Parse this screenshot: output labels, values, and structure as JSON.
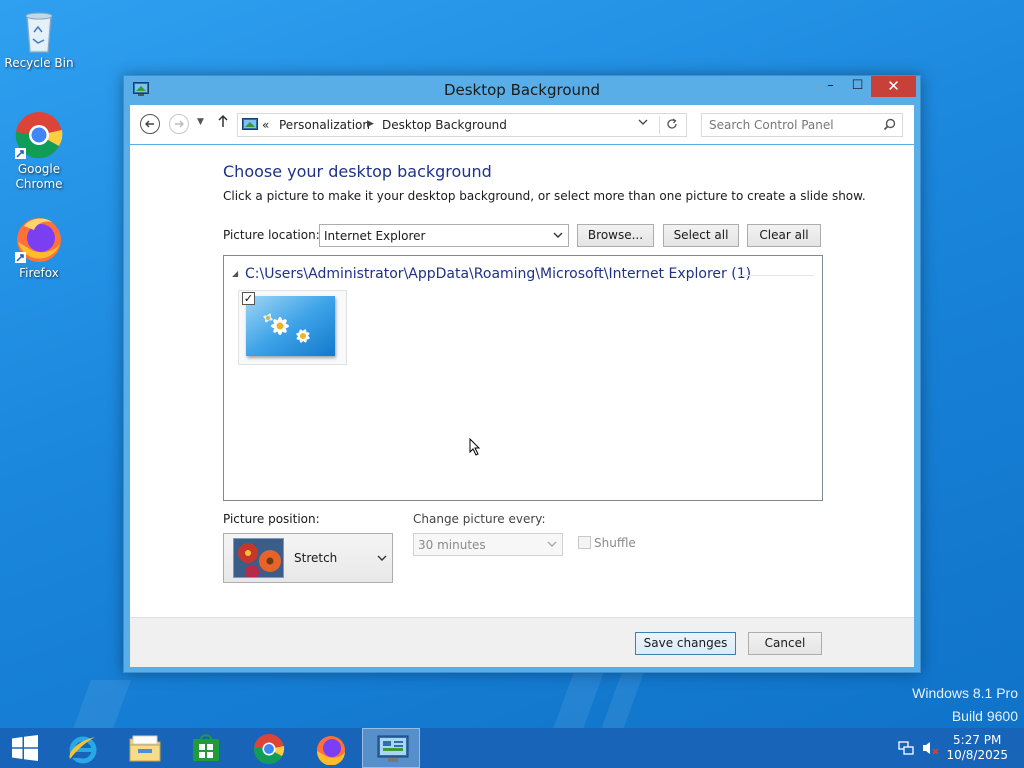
{
  "desktop": {
    "icons": [
      {
        "label": "Recycle Bin",
        "icon": "recycle-bin-icon"
      },
      {
        "label": "Google Chrome",
        "icon": "chrome-icon"
      },
      {
        "label": "Firefox",
        "icon": "firefox-icon"
      }
    ],
    "watermark": {
      "line1": "Windows 8.1 Pro",
      "line2": "Build 9600"
    }
  },
  "window": {
    "title": "Desktop Background",
    "controls": {
      "minimize": "–",
      "maximize": "☐",
      "close": "✕"
    },
    "address": {
      "overflow": "«",
      "breadcrumb": [
        "Personalization",
        "Desktop Background"
      ]
    },
    "search": {
      "placeholder": "Search Control Panel"
    }
  },
  "main": {
    "heading": "Choose your desktop background",
    "subtext": "Click a picture to make it your desktop background, or select more than one picture to create a slide show.",
    "picture_location": {
      "label": "Picture location:",
      "value": "Internet Explorer",
      "buttons": {
        "browse": "Browse...",
        "select_all": "Select all",
        "clear_all": "Clear all"
      }
    },
    "gallery": {
      "group_title": "C:\\Users\\Administrator\\AppData\\Roaming\\Microsoft\\Internet Explorer (1)",
      "items": [
        {
          "checked": true,
          "name": "daisies-wallpaper"
        }
      ]
    },
    "picture_position": {
      "label": "Picture position:",
      "value": "Stretch"
    },
    "change_picture": {
      "label": "Change picture every:",
      "value": "30 minutes",
      "enabled": false
    },
    "shuffle": {
      "label": "Shuffle",
      "checked": false,
      "enabled": false
    }
  },
  "footer": {
    "save": "Save changes",
    "cancel": "Cancel"
  },
  "taskbar": {
    "items": [
      {
        "name": "start-button",
        "icon": "windows-logo-icon"
      },
      {
        "name": "internet-explorer",
        "icon": "internet-explorer-icon"
      },
      {
        "name": "file-explorer",
        "icon": "folder-icon"
      },
      {
        "name": "store",
        "icon": "store-icon"
      },
      {
        "name": "chrome",
        "icon": "chrome-icon"
      },
      {
        "name": "firefox",
        "icon": "firefox-icon"
      },
      {
        "name": "control-panel",
        "icon": "control-panel-icon",
        "active": true
      }
    ],
    "clock": {
      "time": "5:27 PM",
      "date": "10/8/2025"
    }
  },
  "colors": {
    "desktop": "#1a86dc",
    "taskbar": "#1764b8",
    "window_frame": "#5aaee8",
    "close_button": "#c7403a",
    "heading": "#1e3287"
  }
}
